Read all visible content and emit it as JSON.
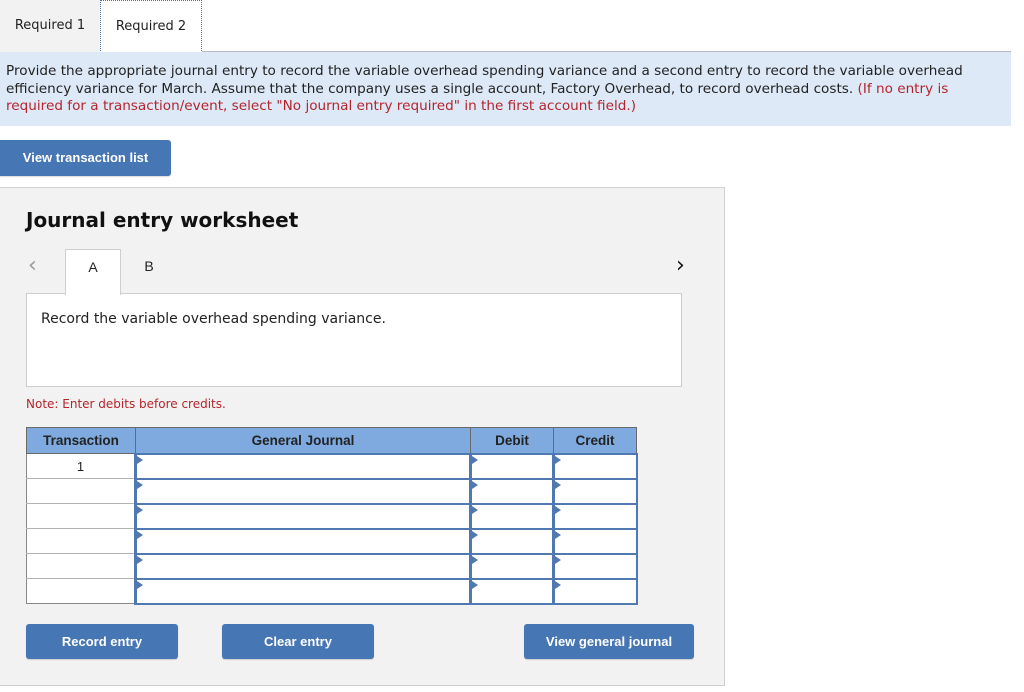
{
  "tabs": [
    {
      "label": "Required 1",
      "active": false
    },
    {
      "label": "Required 2",
      "active": true
    }
  ],
  "instructions": {
    "main": "Provide the appropriate journal entry to record the variable overhead spending variance and a second entry to record the variable overhead efficiency variance for March. Assume that the company uses a single account, Factory Overhead, to record overhead costs.",
    "note": "(If no entry is required for a transaction/event, select \"No journal entry required\" in the first account field.)"
  },
  "view_transaction_list_label": "View transaction list",
  "worksheet": {
    "title": "Journal entry worksheet",
    "prev_icon": "chevron-left-icon",
    "next_icon": "chevron-right-icon",
    "entry_tabs": [
      {
        "label": "A",
        "active": true
      },
      {
        "label": "B",
        "active": false
      }
    ],
    "description": "Record the variable overhead spending variance.",
    "note": "Note: Enter debits before credits.",
    "table": {
      "headers": [
        "Transaction",
        "General Journal",
        "Debit",
        "Credit"
      ],
      "rows": [
        {
          "transaction": "1",
          "account": "",
          "debit": "",
          "credit": ""
        },
        {
          "transaction": "",
          "account": "",
          "debit": "",
          "credit": ""
        },
        {
          "transaction": "",
          "account": "",
          "debit": "",
          "credit": ""
        },
        {
          "transaction": "",
          "account": "",
          "debit": "",
          "credit": ""
        },
        {
          "transaction": "",
          "account": "",
          "debit": "",
          "credit": ""
        },
        {
          "transaction": "",
          "account": "",
          "debit": "",
          "credit": ""
        }
      ]
    },
    "buttons": {
      "record": "Record entry",
      "clear": "Clear entry",
      "view_general_journal": "View general journal"
    }
  },
  "colors": {
    "accent": "#4776b4",
    "table_header": "#7faadf",
    "instruction_bg": "#dde9f7",
    "warning_text": "#b4252c"
  }
}
